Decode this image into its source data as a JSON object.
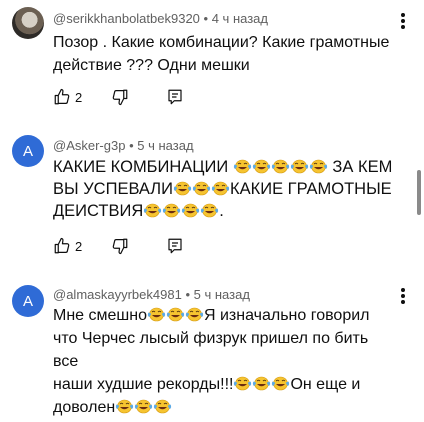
{
  "comments": [
    {
      "author": "@serikkhanbolatbek9320",
      "time": "4 ч назад",
      "lines": [
        "Позор . Какие комбинации? Какие грамотные",
        "действие ??? Одни мешки"
      ],
      "likes": "2",
      "avatar_letter": ""
    },
    {
      "author": "@Asker-g3p",
      "time": "5 ч назад",
      "text_parts": [
        "КАКИЕ КОМБИНАЦИИ",
        "ЗА КЕМ",
        "ВЫ УСПЕВАЛИ",
        "КАКИЕ ГРАМОТНЫЕ",
        "ДЕИСТВИЯ",
        "."
      ],
      "likes": "2",
      "avatar_letter": "A"
    },
    {
      "author": "@almaskayyrbek4981",
      "time": "5 ч назад",
      "text_parts": [
        "Мне смешно",
        "Я изначально говорил",
        "что Черчес лысый физрук пришел по бить все",
        "наши худшие рекорды!!!",
        "Он еще и",
        "доволен"
      ],
      "avatar_letter": "A"
    }
  ],
  "separator": "•",
  "icons": {
    "like": "thumb-up-icon",
    "dislike": "thumb-down-icon",
    "reply": "reply-comment-icon",
    "more": "more-vertical-icon",
    "emoji": "face-with-tears-of-joy-emoji"
  },
  "colors": {
    "avatar_letter_bg": "#2f6bd6",
    "meta_text": "#606060",
    "emoji_face": "#f6c430",
    "emoji_tears": "#5aa9e6"
  }
}
